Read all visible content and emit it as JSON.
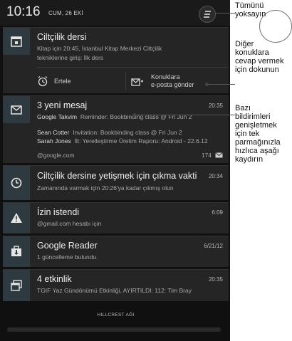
{
  "status": {
    "time": "10:16",
    "date": "CUM, 26 EKİ"
  },
  "notifications": [
    {
      "title": "Ciltçilik dersi",
      "line1": "Kitap için 20:45, İstanbul Kitap Merkezi Ciltçilik",
      "line2": "tekniklerine giriş: İlk ders",
      "actions": {
        "snooze": "Ertele",
        "email_line1": "Konuklara",
        "email_line2": "e-posta gönder"
      }
    },
    {
      "title": "3 yeni mesaj",
      "time": "20:35",
      "rows": [
        {
          "from": "Google Takvim",
          "text": "Reminder: Bookbinding class @ Fri Jun 2"
        },
        {
          "from": "Sean Cotter",
          "text": "Invitation: Bookbinding class @ Fri Jun 2"
        },
        {
          "from": "Sarah Jones",
          "text": "İlt: Yerelleştirme Üretim Raporu: Android - 22.6.12"
        }
      ],
      "account": "@google.com",
      "count": "174"
    },
    {
      "title": "Ciltçilik dersine yetişmek için çıkma vakti",
      "time": "20:34",
      "sub": "Zamanında varmak için 20:26'ya kadar çıkmış olun"
    },
    {
      "title": "İzin istendi",
      "time": "6:09",
      "sub": "@gmail.com hesabı için"
    },
    {
      "title": "Google Reader",
      "time": "6/21/12",
      "sub": "1 güncelleme bulundu."
    },
    {
      "title": "4 etkinlik",
      "time": "20:35",
      "sub": "TGIF Yaz Gündönümü Etkinliği, AYIRTILDI: 112: Tim Bray"
    }
  ],
  "footer": "HILLCREST AĞI",
  "callouts": {
    "c1_l1": "Tümünü",
    "c1_l2": "yoksayın",
    "c2_l1": "Diğer",
    "c2_l2": "konuklara",
    "c2_l3": "cevap vermek",
    "c2_l4": "için dokunun",
    "c3_l1": "Bazı",
    "c3_l2": "bildirimleri",
    "c3_l3": "genişletmek",
    "c3_l4": "için tek",
    "c3_l5": "parmağınızla",
    "c3_l6": "hızlıca aşağı",
    "c3_l7": "kaydırın"
  }
}
